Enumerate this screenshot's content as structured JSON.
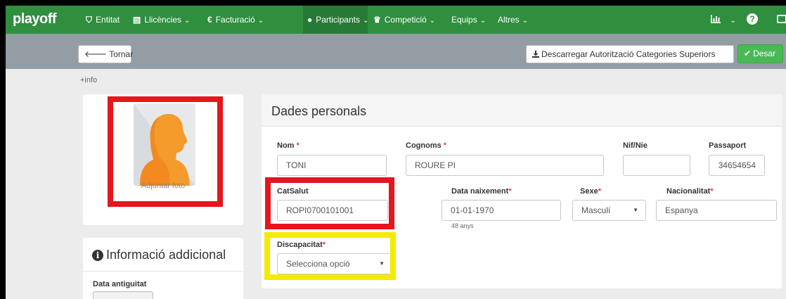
{
  "nav": {
    "logo": "playoff",
    "items": [
      {
        "icon": "shield-icon",
        "glyph": "⛉",
        "label": "Entitat",
        "caret": ""
      },
      {
        "icon": "id-card-icon",
        "glyph": "▤",
        "label": "Llicències",
        "caret": "⌄"
      },
      {
        "icon": "euro-icon",
        "glyph": "€",
        "label": "Facturació",
        "caret": "⌄"
      },
      {
        "icon": "user-icon",
        "glyph": "●",
        "label": "Participants",
        "caret": "⌄"
      },
      {
        "icon": "trophy-icon",
        "glyph": "♛",
        "label": "Competició",
        "caret": "⌄"
      },
      {
        "icon": "",
        "glyph": "",
        "label": "Equips",
        "caret": "⌄"
      },
      {
        "icon": "",
        "glyph": "",
        "label": "Altres",
        "caret": "⌄"
      }
    ],
    "right_caret": "⌄",
    "help_glyph": "?"
  },
  "toolbar": {
    "back_label": "Tornar",
    "download_label": "Descarregar Autorització Categories Superiors",
    "save_label": "Desar"
  },
  "info_link": "+info",
  "photo": {
    "upload_label": "Adjuntar foto"
  },
  "info_panel": {
    "title": "Informació addicional",
    "antiguitat_label": "Data antiguitat",
    "antiguitat_value": ""
  },
  "dades": {
    "title": "Dades personals",
    "nom_label": "Nom",
    "nom_value": "TONI",
    "cognoms_label": "Cognoms",
    "cognoms_value": "ROURE PI",
    "nif_label": "Nif/Nie",
    "nif_value": "",
    "passaport_label": "Passaport",
    "passaport_value": "34654654",
    "catsalut_label": "CatSalut",
    "catsalut_value": "ROPI0700101001",
    "naixement_label": "Data naixement",
    "naixement_value": "01-01-1970",
    "age_hint": "48 anys",
    "sexe_label": "Sexe",
    "sexe_value": "Masculí",
    "nacionalitat_label": "Nacionalitat",
    "nacionalitat_value": "Espanya",
    "discapacitat_label": "Discapacitat",
    "discapacitat_value": "Selecciona opció"
  },
  "required_marker": "*",
  "colors": {
    "nav_bg": "#2f8f3f",
    "toolbar_bg": "#949ca4",
    "save_button": "#49b956",
    "highlight_red": "#e5161e",
    "highlight_yellow": "#f5ea00"
  }
}
